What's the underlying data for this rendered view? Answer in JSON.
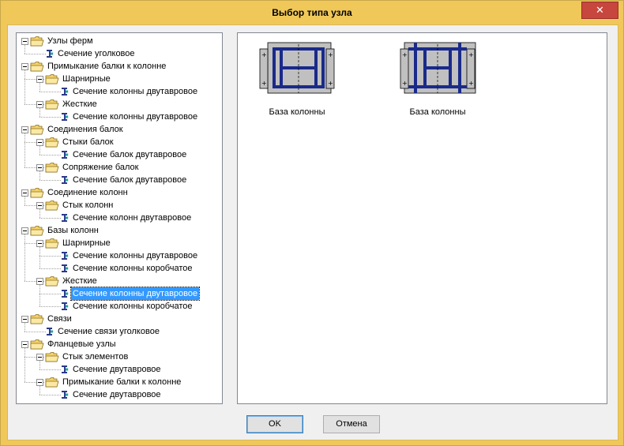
{
  "window": {
    "title": "Выбор типа узла",
    "close": "✕"
  },
  "tree": [
    {
      "label": "Узлы ферм",
      "level": 0,
      "type": "folder"
    },
    {
      "label": "Сечение уголковое",
      "level": 1,
      "type": "leaf"
    },
    {
      "label": "Примыкание балки к колонне",
      "level": 0,
      "type": "folder"
    },
    {
      "label": "Шарнирные",
      "level": 1,
      "type": "folder"
    },
    {
      "label": "Сечение колонны двутавровое",
      "level": 2,
      "type": "leaf"
    },
    {
      "label": "Жесткие",
      "level": 1,
      "type": "folder"
    },
    {
      "label": "Сечение колонны двутавровое",
      "level": 2,
      "type": "leaf"
    },
    {
      "label": "Соединения балок",
      "level": 0,
      "type": "folder"
    },
    {
      "label": "Стыки балок",
      "level": 1,
      "type": "folder"
    },
    {
      "label": "Сечение балок двутавровое",
      "level": 2,
      "type": "leaf"
    },
    {
      "label": "Сопряжение балок",
      "level": 1,
      "type": "folder"
    },
    {
      "label": "Сечение балок двутавровое",
      "level": 2,
      "type": "leaf"
    },
    {
      "label": "Соединение колонн",
      "level": 0,
      "type": "folder"
    },
    {
      "label": "Стык колонн",
      "level": 1,
      "type": "folder"
    },
    {
      "label": "Сечение колонн двутавровое",
      "level": 2,
      "type": "leaf"
    },
    {
      "label": "Базы колонн",
      "level": 0,
      "type": "folder"
    },
    {
      "label": "Шарнирные",
      "level": 1,
      "type": "folder"
    },
    {
      "label": "Сечение колонны двутавровое",
      "level": 2,
      "type": "leaf"
    },
    {
      "label": "Сечение колонны коробчатое",
      "level": 2,
      "type": "leaf"
    },
    {
      "label": "Жесткие",
      "level": 1,
      "type": "folder"
    },
    {
      "label": "Сечение колонны двутавровое",
      "level": 2,
      "type": "leaf",
      "selected": true
    },
    {
      "label": "Сечение колонны коробчатое",
      "level": 2,
      "type": "leaf"
    },
    {
      "label": "Связи",
      "level": 0,
      "type": "folder"
    },
    {
      "label": "Сечение связи уголковое",
      "level": 1,
      "type": "leaf"
    },
    {
      "label": "Фланцевые узлы",
      "level": 0,
      "type": "folder"
    },
    {
      "label": "Стык элементов",
      "level": 1,
      "type": "folder"
    },
    {
      "label": "Сечение двутавровое",
      "level": 2,
      "type": "leaf"
    },
    {
      "label": "Примыкание балки к колонне",
      "level": 1,
      "type": "folder"
    },
    {
      "label": "Сечение двутавровое",
      "level": 2,
      "type": "leaf"
    }
  ],
  "variants": [
    {
      "caption": "База колонны"
    },
    {
      "caption": "База колонны"
    }
  ],
  "buttons": {
    "ok": "OK",
    "cancel": "Отмена"
  },
  "colors": {
    "selection": "#3399ff",
    "steel": "#1a2a8a",
    "plate": "#c0c0c0",
    "folder": "#f3d36b"
  }
}
